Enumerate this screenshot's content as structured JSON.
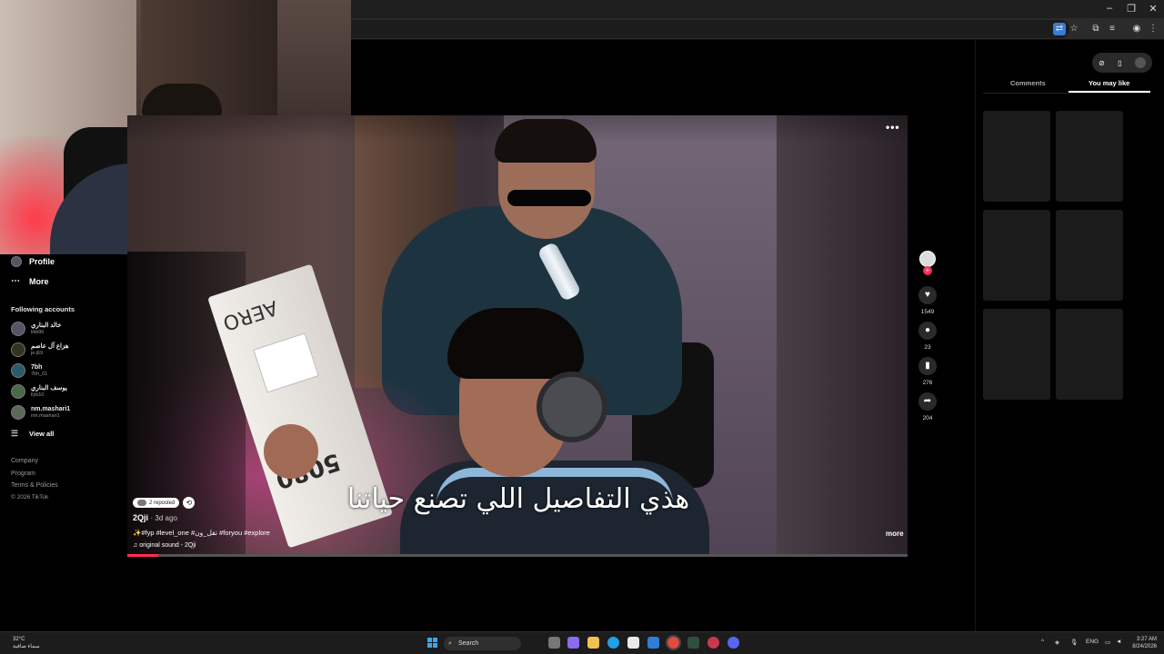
{
  "browser": {
    "window_controls": [
      "–",
      "❐",
      "✕"
    ],
    "toolbar_icons": [
      "translate-icon",
      "star-icon",
      "extensions-icon",
      "media-icon",
      "profile-icon",
      "menu-icon"
    ]
  },
  "sidebar": {
    "nav": [
      {
        "label": "Profile",
        "icon": "profile-avatar"
      },
      {
        "label": "More",
        "icon": "more-dots-icon"
      }
    ],
    "following_heading": "Following accounts",
    "accounts": [
      {
        "name": "خالد البناري",
        "handle": "likb96"
      },
      {
        "name": "هزاع آل عاصم",
        "handle": "je.j69"
      },
      {
        "name": "7bh",
        "handle": "7bh_01"
      },
      {
        "name": "يوسف البناري",
        "handle": "liyb10"
      },
      {
        "name": "nm.mashari1",
        "handle": "nm.mashari1"
      }
    ],
    "view_all": "View all",
    "footer": [
      "Company",
      "Program",
      "Terms & Policies",
      "© 2026 TikTok"
    ]
  },
  "video": {
    "box_brand": "AERO",
    "box_model": "5080",
    "caption": "هذي التفاصيل اللي تصنع حياتنا",
    "more_dots": "•••",
    "reposted_label": "2 reposted",
    "author": "2Qji",
    "posted": "· 3d ago",
    "description": "✨#fyp #level_one #تقل_ون #foryou #explore",
    "sound": "♫  original sound - 2Qji",
    "more_label": "more",
    "progress_fraction": 0.04
  },
  "actions": {
    "likes": "1549",
    "comments": "23",
    "saves": "276",
    "shares": "204"
  },
  "right_panel": {
    "tabs": [
      "Comments",
      "You may like"
    ],
    "active_tab": "You may like"
  },
  "taskbar": {
    "weather_temp": "32°C",
    "weather_desc": "سماء صافية",
    "search_placeholder": "Search",
    "language": "ENG",
    "time": "3:27 AM",
    "date": "8/24/2026"
  },
  "colors": {
    "accent": "#fe2c55",
    "windows_blue": "#3ba6f2"
  }
}
